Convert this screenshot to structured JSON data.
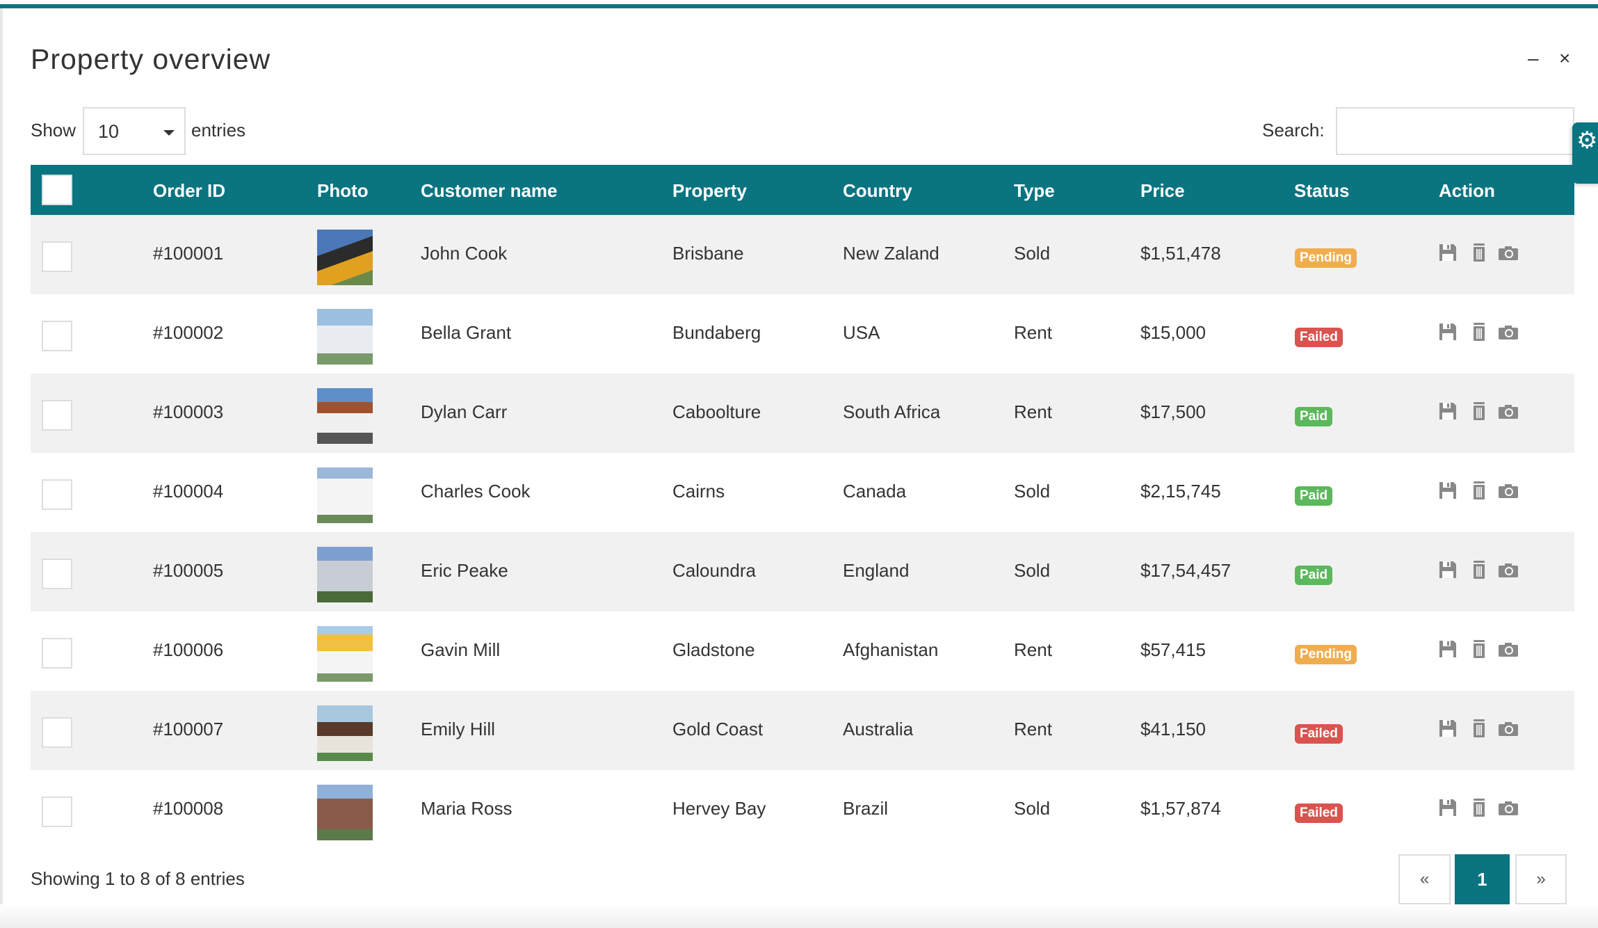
{
  "title": "Property overview",
  "window": {
    "minimize": "–",
    "close": "×"
  },
  "length": {
    "show_label": "Show",
    "value": "10",
    "entries_label": "entries"
  },
  "search": {
    "label": "Search:",
    "value": ""
  },
  "columns": [
    "Order ID",
    "Photo",
    "Customer name",
    "Property",
    "Country",
    "Type",
    "Price",
    "Status",
    "Action"
  ],
  "status_colors": {
    "Pending": "#f0ad4e",
    "Failed": "#d9534f",
    "Paid": "#5cb85c"
  },
  "rows": [
    {
      "id": "#100001",
      "customer": "John Cook",
      "property": "Brisbane",
      "country": "New Zaland",
      "type": "Sold",
      "price": "$1,51,478",
      "status": "Pending"
    },
    {
      "id": "#100002",
      "customer": "Bella Grant",
      "property": "Bundaberg",
      "country": "USA",
      "type": "Rent",
      "price": "$15,000",
      "status": "Failed"
    },
    {
      "id": "#100003",
      "customer": "Dylan Carr",
      "property": "Caboolture",
      "country": "South Africa",
      "type": "Rent",
      "price": "$17,500",
      "status": "Paid"
    },
    {
      "id": "#100004",
      "customer": "Charles Cook",
      "property": "Cairns",
      "country": "Canada",
      "type": "Sold",
      "price": "$2,15,745",
      "status": "Paid"
    },
    {
      "id": "#100005",
      "customer": "Eric Peake",
      "property": "Caloundra",
      "country": "England",
      "type": "Sold",
      "price": "$17,54,457",
      "status": "Paid"
    },
    {
      "id": "#100006",
      "customer": "Gavin Mill",
      "property": "Gladstone",
      "country": "Afghanistan",
      "type": "Rent",
      "price": "$57,415",
      "status": "Pending"
    },
    {
      "id": "#100007",
      "customer": "Emily Hill",
      "property": "Gold Coast",
      "country": "Australia",
      "type": "Rent",
      "price": "$41,150",
      "status": "Failed"
    },
    {
      "id": "#100008",
      "customer": "Maria Ross",
      "property": "Hervey Bay",
      "country": "Brazil",
      "type": "Sold",
      "price": "$1,57,874",
      "status": "Failed"
    }
  ],
  "footer": {
    "info": "Showing 1 to 8 of 8 entries"
  },
  "pagination": {
    "prev": "«",
    "current": "1",
    "next": "»"
  }
}
